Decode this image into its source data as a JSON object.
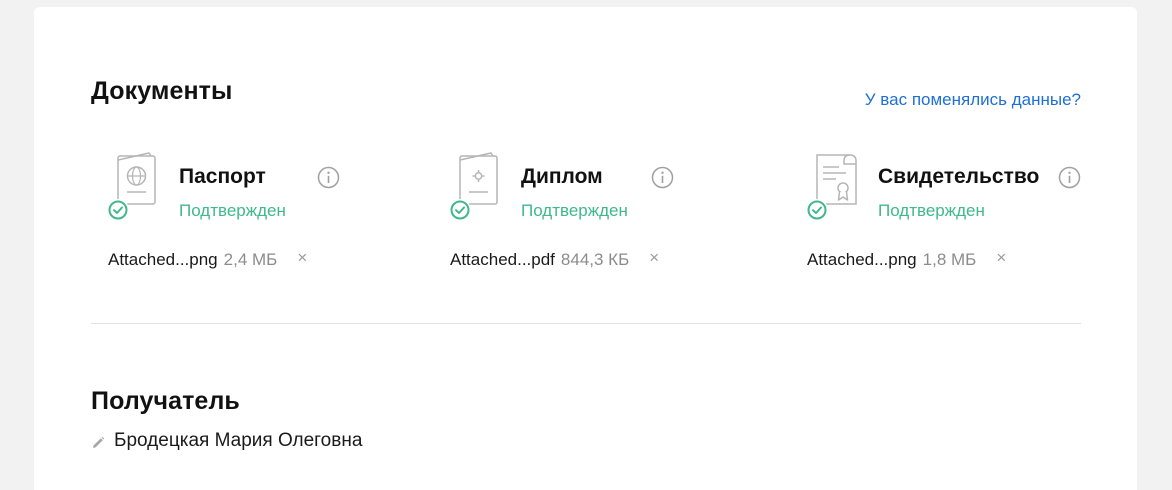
{
  "documents": {
    "title": "Документы",
    "changed_link": "У вас поменялись данные?",
    "items": [
      {
        "name": "Паспорт",
        "status": "Подтвержден",
        "icon": "passport-icon",
        "file_name": "Attached...png",
        "file_size": "2,4 МБ"
      },
      {
        "name": "Диплом",
        "status": "Подтвержден",
        "icon": "diploma-icon",
        "file_name": "Attached...pdf",
        "file_size": "844,3 КБ"
      },
      {
        "name": "Свидетельство",
        "status": "Подтвержден",
        "icon": "certificate-icon",
        "file_name": "Attached...png",
        "file_size": "1,8 МБ"
      }
    ],
    "remove_glyph": "×"
  },
  "recipient": {
    "title": "Получатель",
    "name": "Бродецкая Мария Олеговна"
  },
  "colors": {
    "link": "#1f6fd6",
    "status_ok": "#3fb88a",
    "muted": "#8c8c8c",
    "background": "#f2f2f2",
    "card": "#ffffff"
  }
}
